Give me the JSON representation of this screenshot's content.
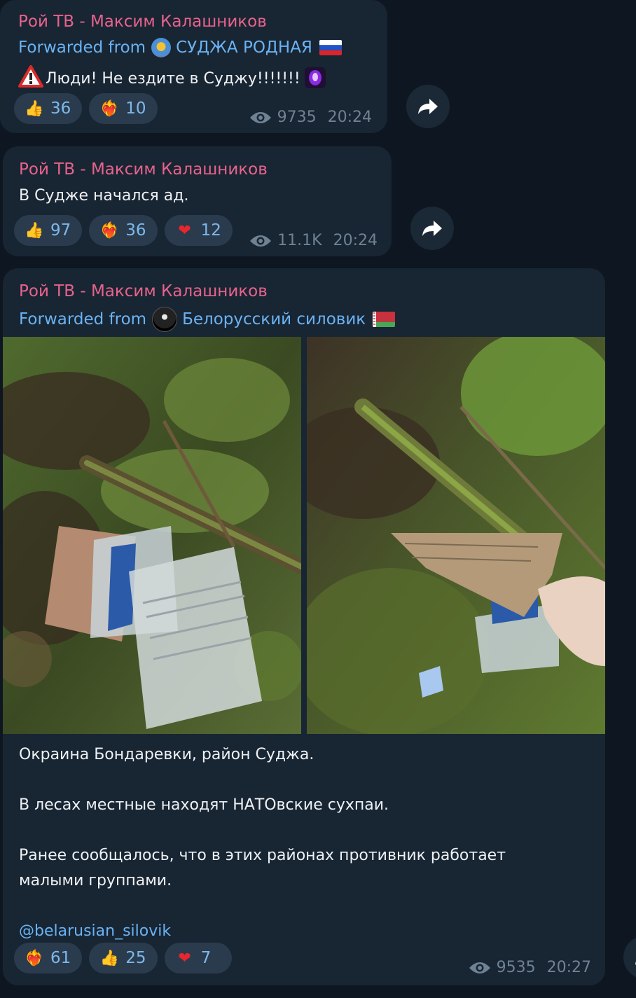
{
  "messages": [
    {
      "author": "Рой ТВ - Максим Калашников",
      "forward_label": "Forwarded from",
      "forward_source": "СУДЖА РОДНАЯ",
      "text": "Люди! Не ездите в Суджу!!!!!!!",
      "reactions": [
        {
          "emoji": "👍",
          "count": "36"
        },
        {
          "emoji": "❤‍🔥",
          "count": "10"
        }
      ],
      "views": "9735",
      "time": "20:24"
    },
    {
      "author": "Рой ТВ - Максим Калашников",
      "text": "В Судже начался ад.",
      "reactions": [
        {
          "emoji": "👍",
          "count": "97"
        },
        {
          "emoji": "❤‍🔥",
          "count": "36"
        },
        {
          "emoji": "❤",
          "count": "12"
        }
      ],
      "views": "11.1K",
      "time": "20:24"
    },
    {
      "author": "Рой ТВ - Максим Калашников",
      "forward_label": "Forwarded from",
      "forward_source": "Белорусский силовик",
      "paragraphs": [
        "Окраина Бондаревки, район Суджа.",
        "В лесах местные находят НАТОвские сухпаи.",
        "Ранее сообщалось, что в этих районах противник работает",
        "малыми группами."
      ],
      "link": "@belarusian_silovik",
      "reactions": [
        {
          "emoji": "❤‍🔥",
          "count": "61"
        },
        {
          "emoji": "👍",
          "count": "25"
        },
        {
          "emoji": "❤",
          "count": "7"
        }
      ],
      "views": "9535",
      "time": "20:27"
    }
  ],
  "colors": {
    "background": "#0e1621",
    "bubble": "#182533",
    "author": "#e8638c",
    "forward": "#6ab3f3",
    "reaction_bg": "#2b3b4e",
    "reaction_count": "#7db9ea",
    "meta": "#6f8294"
  },
  "icons": {
    "warning": "warning-icon",
    "share": "share-arrow-icon",
    "views": "eye-icon"
  }
}
